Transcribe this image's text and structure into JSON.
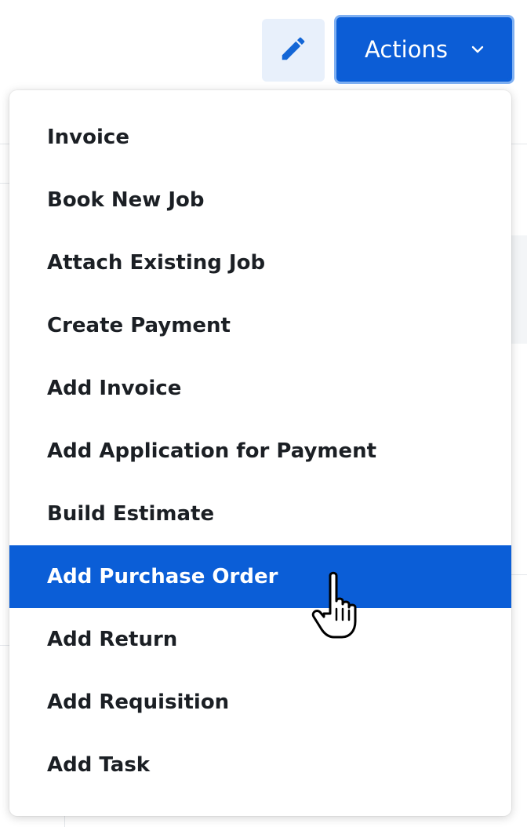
{
  "toolbar": {
    "edit_icon": "pencil-icon",
    "actions_label": "Actions",
    "actions_chevron_icon": "chevron-down-icon",
    "accent_color": "#0b5ed7"
  },
  "dropdown": {
    "items": [
      {
        "label": "Invoice"
      },
      {
        "label": "Book New Job"
      },
      {
        "label": "Attach Existing Job"
      },
      {
        "label": "Create Payment"
      },
      {
        "label": "Add Invoice"
      },
      {
        "label": "Add Application for Payment"
      },
      {
        "label": "Build Estimate"
      },
      {
        "label": "Add Purchase Order",
        "highlighted": true
      },
      {
        "label": "Add Return"
      },
      {
        "label": "Add Requisition"
      },
      {
        "label": "Add Task"
      }
    ],
    "highlight_color": "#0b5ed7"
  },
  "cursor": {
    "icon": "hand-pointer-icon"
  }
}
